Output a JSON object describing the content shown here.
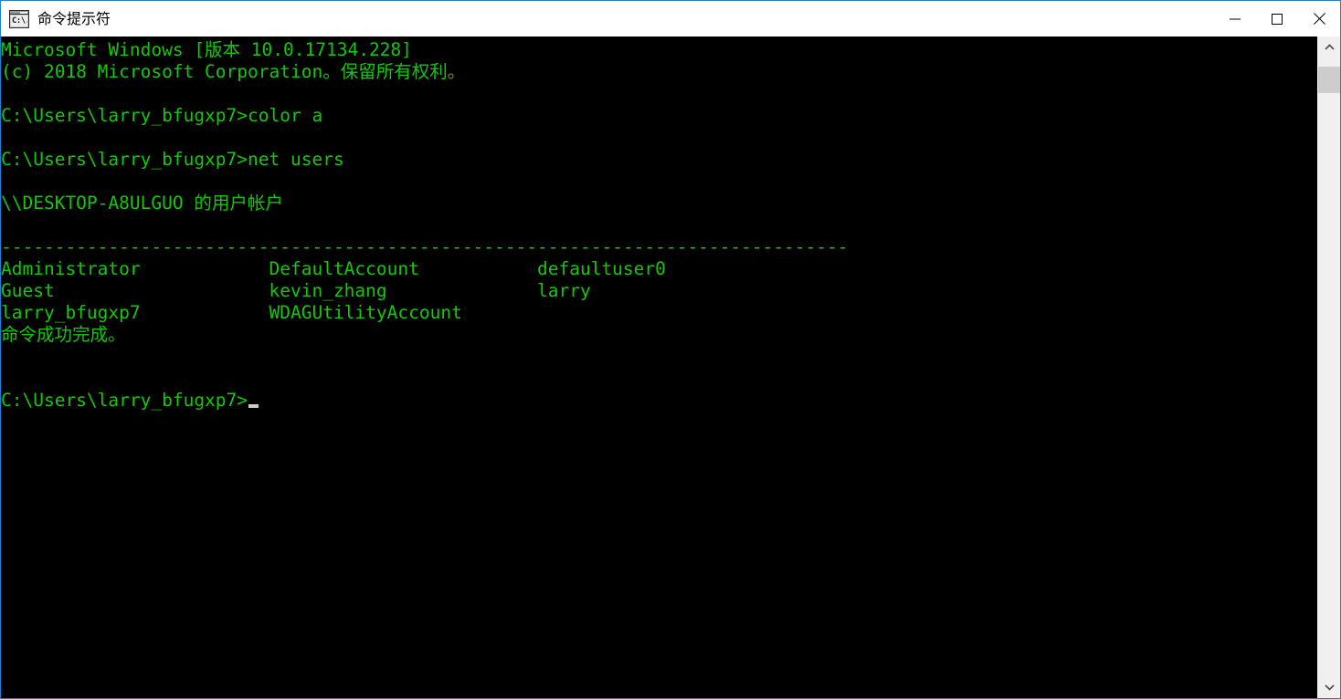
{
  "window": {
    "title": "命令提示符",
    "icon_label": "C:\\.",
    "border_color": "#1f7fd4",
    "titlebar_bg": "#ffffff",
    "controls": [
      {
        "name": "minimize",
        "glyph": "—"
      },
      {
        "name": "maximize",
        "glyph": "□"
      },
      {
        "name": "close",
        "glyph": "✕"
      }
    ]
  },
  "console": {
    "background_color": "#000000",
    "text_color": "#16c60c",
    "cursor_color": "#cccccc",
    "lines": [
      "Microsoft Windows [版本 10.0.17134.228]",
      "(c) 2018 Microsoft Corporation。保留所有权利。",
      "",
      "C:\\Users\\larry_bfugxp7>color a",
      "",
      "C:\\Users\\larry_bfugxp7>net users",
      "",
      "\\\\DESKTOP-A8ULGUO 的用户帐户",
      "",
      "-------------------------------------------------------------------------------",
      "Administrator            DefaultAccount           defaultuser0",
      "Guest                    kevin_zhang              larry",
      "larry_bfugxp7            WDAGUtilityAccount",
      "命令成功完成。",
      "",
      "",
      "C:\\Users\\larry_bfugxp7>"
    ],
    "prompt_last": "C:\\Users\\larry_bfugxp7>",
    "command_1": "color a",
    "command_2": "net users",
    "host_header": "\\\\DESKTOP-A8ULGUO 的用户帐户",
    "status_message": "命令成功完成。",
    "user_accounts": [
      [
        "Administrator",
        "DefaultAccount",
        "defaultuser0"
      ],
      [
        "Guest",
        "kevin_zhang",
        "larry"
      ],
      [
        "larry_bfugxp7",
        "WDAGUtilityAccount",
        ""
      ]
    ]
  },
  "scrollbar": {
    "up_arrow": "˄",
    "down_arrow": "˅",
    "thumb_color": "#cdcdcd",
    "track_color": "#f0f0f0"
  }
}
